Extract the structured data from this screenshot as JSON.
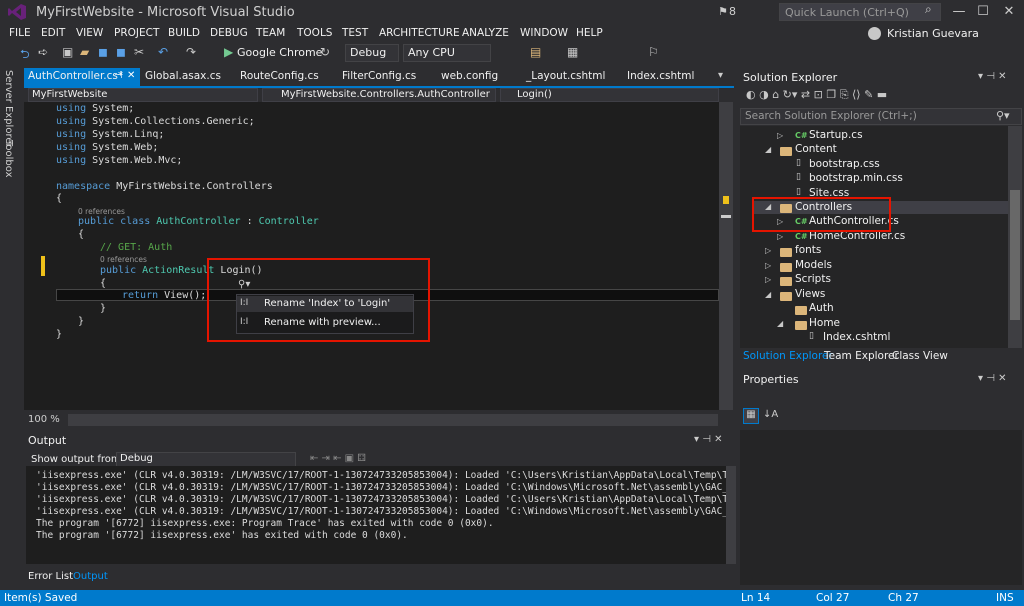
{
  "window": {
    "title": "MyFirstWebsite - Microsoft Visual Studio",
    "notifications": "8",
    "quick_launch_placeholder": "Quick Launch (Ctrl+Q)",
    "user": "Kristian Guevara"
  },
  "menu": [
    "FILE",
    "EDIT",
    "VIEW",
    "PROJECT",
    "BUILD",
    "DEBUG",
    "TEAM",
    "TOOLS",
    "TEST",
    "ARCHITECTURE",
    "ANALYZE",
    "WINDOW",
    "HELP"
  ],
  "toolbar": {
    "browser": "Google Chrome",
    "config": "Debug",
    "platform": "Any CPU"
  },
  "side_tabs": [
    "Server Explorer",
    "Toolbox"
  ],
  "doc_tabs": [
    "AuthController.cs*",
    "Global.asax.cs",
    "RouteConfig.cs",
    "FilterConfig.cs",
    "web.config",
    "_Layout.cshtml",
    "Index.cshtml"
  ],
  "nav": {
    "project": "MyFirstWebsite",
    "class": "MyFirstWebsite.Controllers.AuthController",
    "member": "Login()"
  },
  "code": {
    "using1": "System;",
    "using2": "System.Collections.Generic;",
    "using3": "System.Linq;",
    "using4": "System.Web;",
    "using5": "System.Web.Mvc;",
    "kw_using": "using",
    "kw_namespace": "namespace",
    "namespace_name": " MyFirstWebsite.Controllers",
    "brace_open": "{",
    "brace_close": "}",
    "ref_class": "0 references",
    "kw_public_class": "public class",
    "class_name": " AuthController",
    "colon": " : ",
    "base": "Controller",
    "comment": "// GET: Auth",
    "ref_method": "0 references",
    "kw_public": "public",
    "action_result": " ActionResult",
    "method": " Login()",
    "kw_return": "return",
    "return_rest": " View();"
  },
  "quick_actions": {
    "items": [
      "Rename 'Index' to 'Login'",
      "Rename with preview..."
    ]
  },
  "zoom": "100 %",
  "output": {
    "title": "Output",
    "show_label": "Show output from:",
    "source": "Debug",
    "lines": [
      "'iisexpress.exe' (CLR v4.0.30319: /LM/W3SVC/17/ROOT-1-130724733205853004): Loaded 'C:\\Users\\Kristian\\AppData\\Local\\Temp\\Te",
      "'iisexpress.exe' (CLR v4.0.30319: /LM/W3SVC/17/ROOT-1-130724733205853004): Loaded 'C:\\Windows\\Microsoft.Net\\assembly\\GAC_M",
      "'iisexpress.exe' (CLR v4.0.30319: /LM/W3SVC/17/ROOT-1-130724733205853004): Loaded 'C:\\Users\\Kristian\\AppData\\Local\\Temp\\Te",
      "'iisexpress.exe' (CLR v4.0.30319: /LM/W3SVC/17/ROOT-1-130724733205853004): Loaded 'C:\\Windows\\Microsoft.Net\\assembly\\GAC_M",
      "The program '[6772] iisexpress.exe: Program Trace' has exited with code 0 (0x0).",
      "The program '[6772] iisexpress.exe' has exited with code 0 (0x0)."
    ],
    "bottom_tabs": [
      "Error List",
      "Output"
    ]
  },
  "status": {
    "message": "Item(s) Saved",
    "ln": "Ln 14",
    "col": "Col 27",
    "ch": "Ch 27",
    "mode": "INS"
  },
  "solution_explorer": {
    "title": "Solution Explorer",
    "search_placeholder": "Search Solution Explorer (Ctrl+;)",
    "items": [
      {
        "label": "Startup.cs",
        "kind": "cs"
      },
      {
        "label": "Content",
        "kind": "folder-open"
      },
      {
        "label": "bootstrap.css",
        "kind": "file"
      },
      {
        "label": "bootstrap.min.css",
        "kind": "file"
      },
      {
        "label": "Site.css",
        "kind": "file"
      },
      {
        "label": "Controllers",
        "kind": "folder-open"
      },
      {
        "label": "AuthController.cs",
        "kind": "cs"
      },
      {
        "label": "HomeController.cs",
        "kind": "cs"
      },
      {
        "label": "fonts",
        "kind": "folder"
      },
      {
        "label": "Models",
        "kind": "folder"
      },
      {
        "label": "Scripts",
        "kind": "folder"
      },
      {
        "label": "Views",
        "kind": "folder-open"
      },
      {
        "label": "Auth",
        "kind": "folder"
      },
      {
        "label": "Home",
        "kind": "folder-open"
      },
      {
        "label": "Index.cshtml",
        "kind": "file"
      }
    ],
    "tabs": [
      "Solution Explorer",
      "Team Explorer",
      "Class View"
    ]
  },
  "properties": {
    "title": "Properties"
  },
  "colors": {
    "accent": "#007acc",
    "highlight": "#e51400"
  }
}
